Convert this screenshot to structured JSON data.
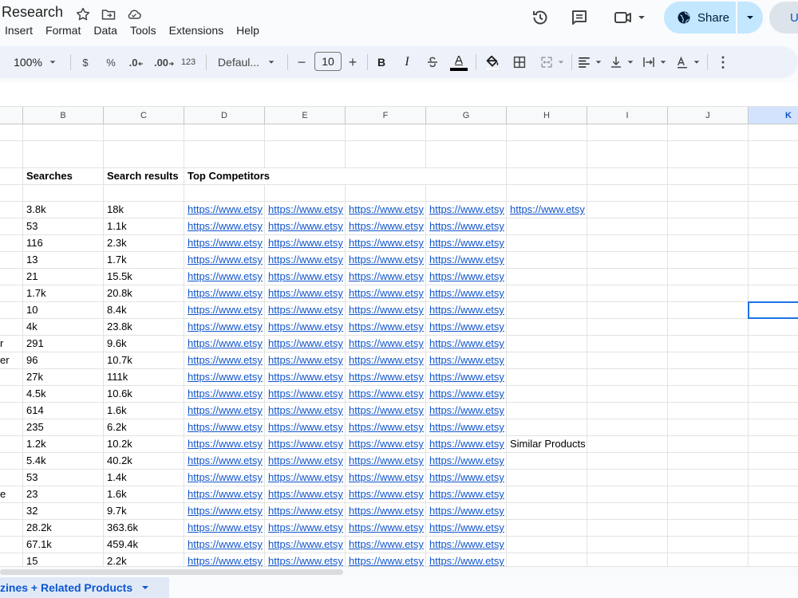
{
  "doc": {
    "title": "Research"
  },
  "menu": [
    "Insert",
    "Format",
    "Data",
    "Tools",
    "Extensions",
    "Help"
  ],
  "share": {
    "label": "Share"
  },
  "avatar": {
    "initial": "U"
  },
  "toolbar": {
    "zoom": "100%",
    "currency": "$",
    "percent": "%",
    "dec_decrease": ".0",
    "dec_increase": ".00",
    "number_format": "123",
    "font": "Defaul...",
    "minus": "−",
    "font_size": "10",
    "plus": "+",
    "bold": "B",
    "italic": "I",
    "text_color": "A",
    "more": "⋮"
  },
  "columns": [
    "B",
    "C",
    "D",
    "E",
    "F",
    "G",
    "H",
    "I",
    "J",
    "K"
  ],
  "selected_column": "K",
  "headers": {
    "searches": "Searches",
    "search_results": "Search results",
    "top_competitors": "Top Competitors"
  },
  "rows": [
    {
      "a": "",
      "b": "3.8k",
      "c": "18k",
      "links": 5,
      "h": ""
    },
    {
      "a": "",
      "b": "53",
      "c": "1.1k",
      "links": 4,
      "h": ""
    },
    {
      "a": "",
      "b": "116",
      "c": "2.3k",
      "links": 4,
      "h": ""
    },
    {
      "a": "",
      "b": "13",
      "c": "1.7k",
      "links": 4,
      "h": ""
    },
    {
      "a": "",
      "b": "21",
      "c": "15.5k",
      "links": 4,
      "h": ""
    },
    {
      "a": "",
      "b": "1.7k",
      "c": "20.8k",
      "links": 4,
      "h": ""
    },
    {
      "a": "",
      "b": "10",
      "c": "8.4k",
      "links": 4,
      "h": ""
    },
    {
      "a": "",
      "b": "4k",
      "c": "23.8k",
      "links": 4,
      "h": ""
    },
    {
      "a": "r",
      "b": "291",
      "c": "9.6k",
      "links": 4,
      "h": ""
    },
    {
      "a": "er",
      "b": "96",
      "c": "10.7k",
      "links": 4,
      "h": ""
    },
    {
      "a": "",
      "b": "27k",
      "c": "111k",
      "links": 4,
      "h": ""
    },
    {
      "a": "",
      "b": "4.5k",
      "c": "10.6k",
      "links": 4,
      "h": ""
    },
    {
      "a": "",
      "b": "614",
      "c": "1.6k",
      "links": 4,
      "h": ""
    },
    {
      "a": "",
      "b": "235",
      "c": "6.2k",
      "links": 4,
      "h": ""
    },
    {
      "a": "",
      "b": "1.2k",
      "c": "10.2k",
      "links": 4,
      "h": "Similar Products"
    },
    {
      "a": "",
      "b": "5.4k",
      "c": "40.2k",
      "links": 4,
      "h": ""
    },
    {
      "a": "",
      "b": "53",
      "c": "1.4k",
      "links": 4,
      "h": ""
    },
    {
      "a": "e",
      "b": "23",
      "c": "1.6k",
      "links": 4,
      "h": ""
    },
    {
      "a": "",
      "b": "32",
      "c": "9.7k",
      "links": 4,
      "h": ""
    },
    {
      "a": "",
      "b": "28.2k",
      "c": "363.6k",
      "links": 4,
      "h": ""
    },
    {
      "a": "",
      "b": "67.1k",
      "c": "459.4k",
      "links": 4,
      "h": ""
    },
    {
      "a": "",
      "b": "15",
      "c": "2.2k",
      "links": 4,
      "h": ""
    }
  ],
  "link_text": "https://www.etsy",
  "sheet_tab": {
    "label": "zines + Related Products"
  },
  "colors": {
    "link": "#1155cc",
    "accent": "#0b57d0",
    "share_bg": "#c2e7ff",
    "selection": "#1a73e8"
  }
}
